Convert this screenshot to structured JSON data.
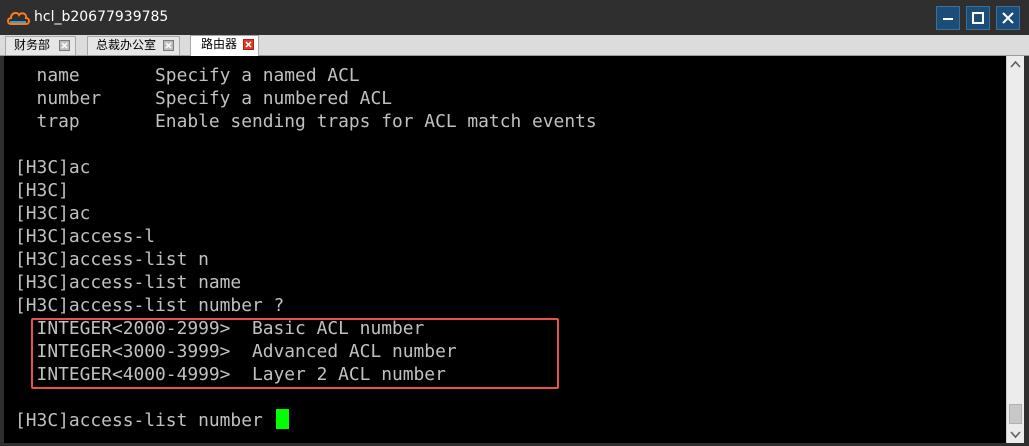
{
  "window": {
    "title": "hcl_b20677939785",
    "app_icon": "cloud-logo-icon",
    "controls": [
      "minimize-icon",
      "maximize-icon",
      "close-icon"
    ],
    "accent_color": "#1b4d78"
  },
  "tabs": [
    {
      "label": "财务部",
      "active": false
    },
    {
      "label": "总裁办公室",
      "active": false
    },
    {
      "label": "路由器",
      "active": true
    }
  ],
  "terminal": {
    "text_color": "#c0c0c0",
    "cursor_color": "#00ff00",
    "highlight_color": "#e8524a",
    "lines": [
      "  name       Specify a named ACL",
      "  number     Specify a numbered ACL",
      "  trap       Enable sending traps for ACL match events",
      "",
      "[H3C]ac",
      "[H3C]",
      "[H3C]ac",
      "[H3C]access-l",
      "[H3C]access-list n",
      "[H3C]access-list name",
      "[H3C]access-list number ?",
      "  INTEGER<2000-2999>  Basic ACL number",
      "  INTEGER<3000-3999>  Advanced ACL number",
      "  INTEGER<4000-4999>  Layer 2 ACL number",
      "",
      "[H3C]access-list number "
    ]
  }
}
